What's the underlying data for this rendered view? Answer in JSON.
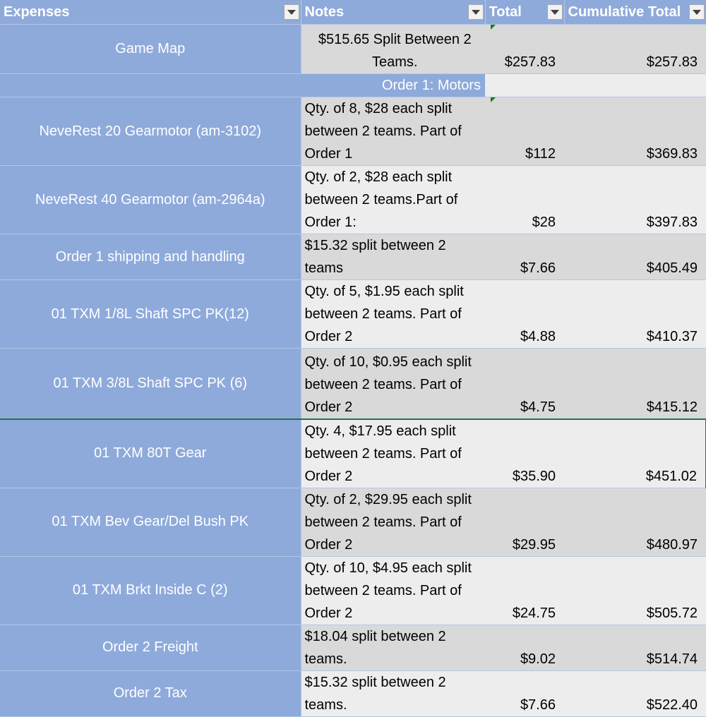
{
  "headers": {
    "expenses": "Expenses",
    "notes": "Notes",
    "total": "Total",
    "cumulative": "Cumulative Total"
  },
  "section": "Order 1: Motors",
  "rows": [
    {
      "item": "Game Map",
      "notes": "$515.65 Split Between 2 Teams.",
      "total": "$257.83",
      "cumulative": "$257.83"
    },
    {
      "item": "NeveRest 20 Gearmotor (am-3102)",
      "notes": "Qty. of 8, $28 each split between 2 teams. Part of Order 1",
      "total": "$112",
      "cumulative": "$369.83"
    },
    {
      "item": "NeveRest 40 Gearmotor (am-2964a)",
      "notes": "Qty. of 2, $28 each split between 2 teams.Part of Order 1:",
      "total": "$28",
      "cumulative": "$397.83"
    },
    {
      "item": "Order 1 shipping and handling",
      "notes": "$15.32 split between 2 teams",
      "total": "$7.66",
      "cumulative": "$405.49"
    },
    {
      "item": "01 TXM 1/8L Shaft SPC PK(12)",
      "notes": "Qty. of 5, $1.95 each split between 2 teams. Part of Order 2",
      "total": "$4.88",
      "cumulative": "$410.37"
    },
    {
      "item": "01 TXM 3/8L Shaft SPC PK (6)",
      "notes": "Qty. of 10, $0.95 each split between 2 teams. Part of Order 2",
      "total": "$4.75",
      "cumulative": "$415.12"
    },
    {
      "item": "01 TXM 80T Gear",
      "notes": "Qty. 4, $17.95 each split between 2 teams. Part of Order 2",
      "total": "$35.90",
      "cumulative": "$451.02"
    },
    {
      "item": "01 TXM Bev Gear/Del Bush PK",
      "notes": "Qty. of 2, $29.95 each split between 2 teams. Part of Order 2",
      "total": "$29.95",
      "cumulative": "$480.97"
    },
    {
      "item": "01 TXM Brkt Inside C (2)",
      "notes": "Qty. of 10, $4.95 each split between 2 teams. Part of Order 2",
      "total": "$24.75",
      "cumulative": "$505.72"
    },
    {
      "item": "Order 2 Freight",
      "notes": "$18.04 split between 2 teams.",
      "total": "$9.02",
      "cumulative": "$514.74"
    },
    {
      "item": "Order 2 Tax",
      "notes": "$15.32 split between 2 teams.",
      "total": "$7.66",
      "cumulative": "$522.40"
    }
  ]
}
